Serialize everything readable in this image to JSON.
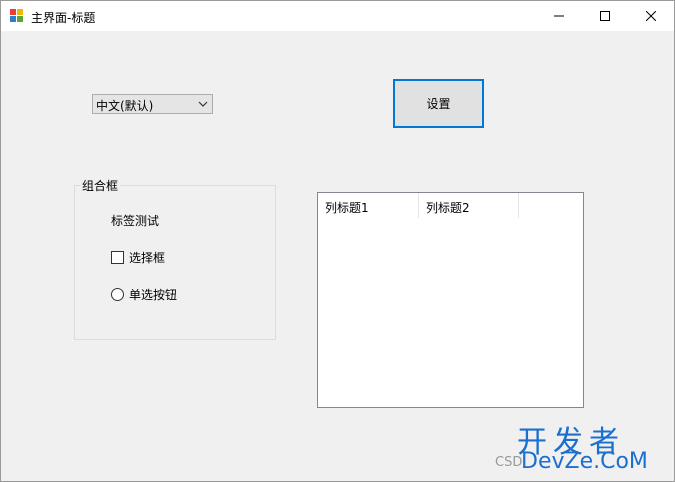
{
  "window": {
    "title": "主界面-标题"
  },
  "combo": {
    "selected": "中文(默认)"
  },
  "settings_button": {
    "label": "设置"
  },
  "groupbox": {
    "title": "组合框",
    "label": "标签测试",
    "checkbox_label": "选择框",
    "radio_label": "单选按钮"
  },
  "listview": {
    "columns": [
      "列标题1",
      "列标题2"
    ]
  },
  "watermark": {
    "top": "开发者",
    "bottom": "DevZe.CoM",
    "csdn": "CSD"
  },
  "colors": {
    "window_bg": "#f0f0f0",
    "focus_border": "#0078d7",
    "watermark": "#1a6fcf"
  },
  "icons": [
    "app-icon",
    "minimize-icon",
    "maximize-icon",
    "close-icon",
    "chevron-down-icon",
    "checkbox-icon",
    "radio-icon"
  ]
}
